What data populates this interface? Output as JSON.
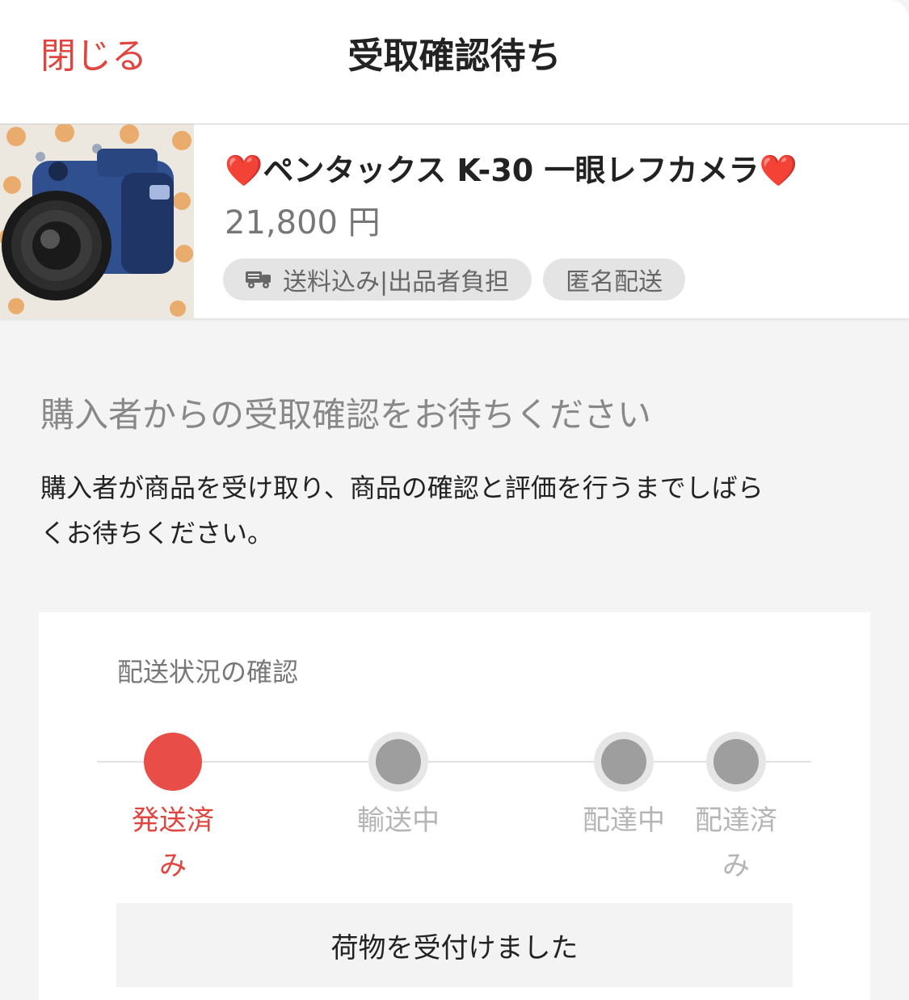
{
  "header": {
    "close_label": "閉じる",
    "title": "受取確認待ち"
  },
  "item": {
    "name_prefix": "❤️",
    "name": "ペンタックス K-30 一眼レフカメラ",
    "name_suffix": "❤️",
    "price": "21,800 円",
    "tags": {
      "shipping": "送料込み|出品者負担",
      "anonymous": "匿名配送"
    }
  },
  "message": {
    "headline": "購入者からの受取確認をお待ちください",
    "body_line1": "購入者が商品を受け取り、商品の確認と評価を行うまでしばら",
    "body_line2": "くお待ちください。"
  },
  "shipping_status": {
    "title": "配送状況の確認",
    "steps": [
      {
        "label_line1": "発送済",
        "label_line2": "み",
        "active": true
      },
      {
        "label_line1": "輸送中",
        "label_line2": "",
        "active": false
      },
      {
        "label_line1": "配達中",
        "label_line2": "",
        "active": false
      },
      {
        "label_line1": "配達済",
        "label_line2": "み",
        "active": false
      }
    ],
    "latest_event": "荷物を受付けました"
  },
  "colors": {
    "accent": "#e0463f",
    "inactive_dot": "#9e9e9e",
    "background": "#f4f4f4"
  },
  "icons": {
    "shipping_tag": "truck-icon",
    "title_emoji": "heart-icon"
  }
}
